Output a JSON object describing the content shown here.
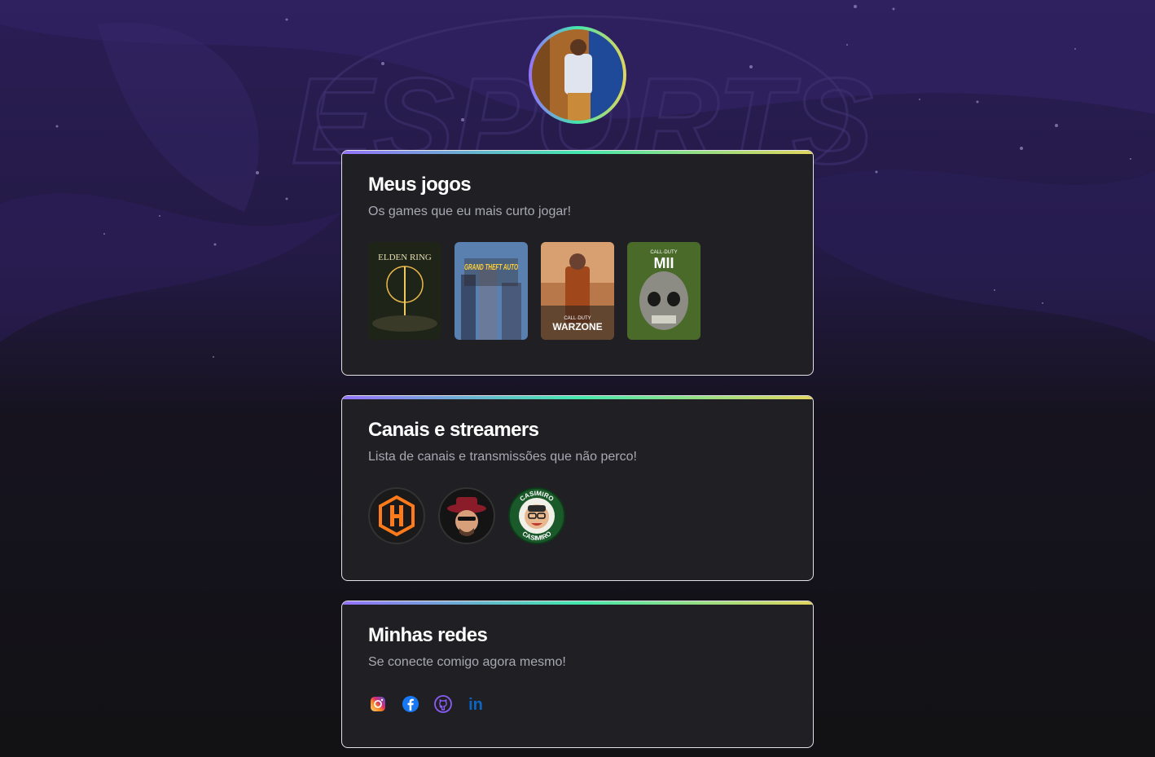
{
  "profile": {
    "avatar_alt": "profile photo"
  },
  "sections": {
    "games": {
      "title": "Meus jogos",
      "subtitle": "Os games que eu mais curto jogar!",
      "items": [
        {
          "id": "elden-ring",
          "caption": "ELDEN RING"
        },
        {
          "id": "gta",
          "caption": "GRAND THEFT AUTO"
        },
        {
          "id": "warzone",
          "caption_top": "CALL·DUTY",
          "caption": "WARZONE"
        },
        {
          "id": "mw2",
          "caption_top": "CALL·DUTY",
          "caption": "MII"
        }
      ]
    },
    "streamers": {
      "title": "Canais e streamers",
      "subtitle": "Lista de canais e transmissões que não perco!",
      "items": [
        {
          "id": "hardlevel",
          "icon": "h-logo-icon"
        },
        {
          "id": "streamer-hat",
          "icon": "hat-avatar-icon"
        },
        {
          "id": "casimiro",
          "label": "CASIMIRO"
        }
      ]
    },
    "socials": {
      "title": "Minhas redes",
      "subtitle": "Se conecte comigo agora mesmo!",
      "items": [
        {
          "id": "instagram",
          "icon": "instagram-icon"
        },
        {
          "id": "facebook",
          "icon": "facebook-icon"
        },
        {
          "id": "github",
          "icon": "github-icon"
        },
        {
          "id": "linkedin",
          "icon": "linkedin-icon",
          "label": "in"
        }
      ]
    }
  },
  "colors": {
    "gradient": [
      "#9572fc",
      "#43e7ad",
      "#e1d55d"
    ],
    "card_bg": "#202024",
    "title": "#ffffff",
    "subtitle": "#a8a8b3"
  }
}
